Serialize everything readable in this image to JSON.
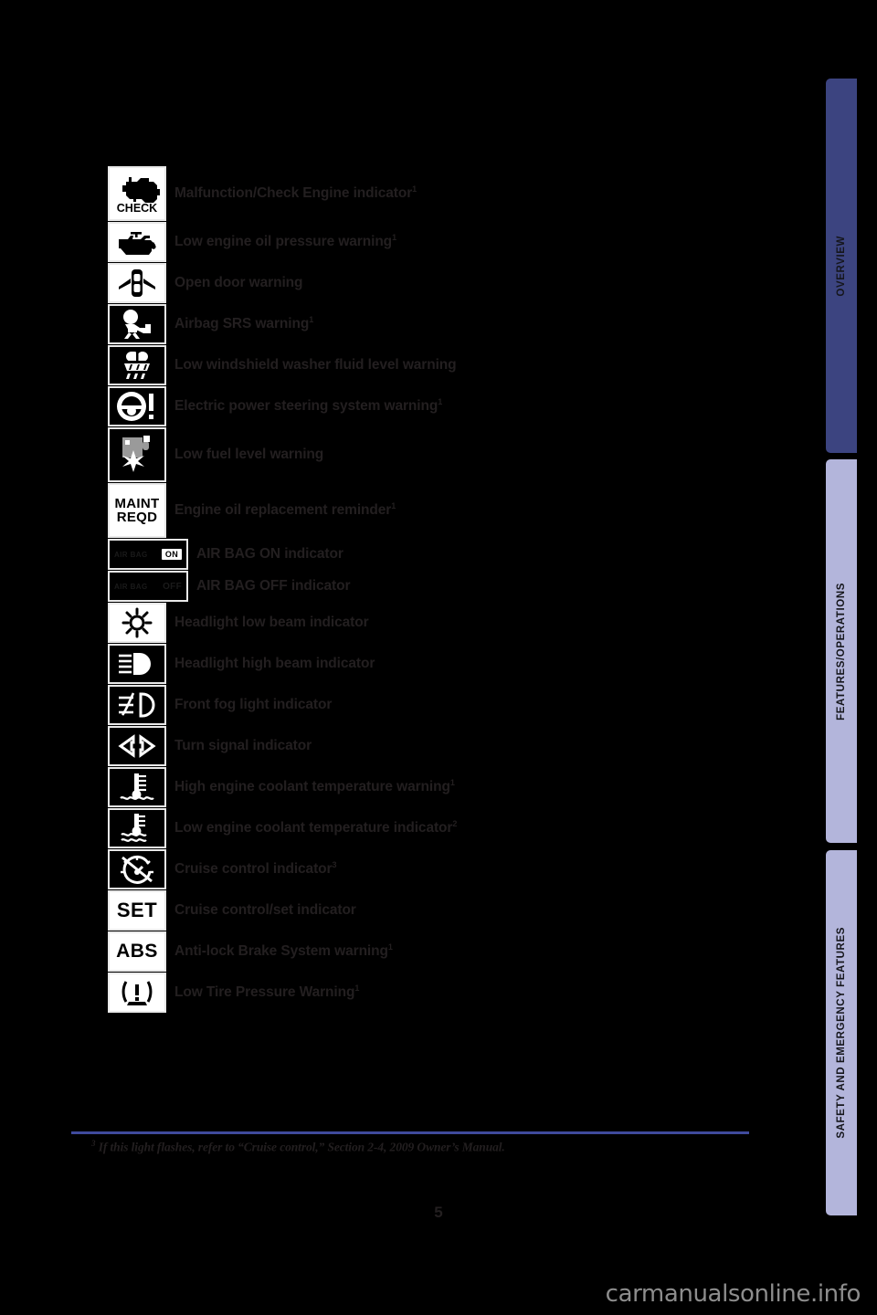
{
  "page": {
    "number": "5",
    "watermark": "carmanualsonline.info",
    "background_color": "#000000",
    "text_color": "#231f20"
  },
  "footnote": {
    "marker": "3",
    "text": "If this light flashes, refer to “Cruise control,” Section 2-4, 2009 Owner’s Manual.",
    "rule_color": "#3f4a9c"
  },
  "indicators": [
    {
      "icon": "check-engine-icon",
      "icon_text": "CHECK",
      "icon_style": "light",
      "label": "Malfunction/Check Engine indicator",
      "footnote": "1"
    },
    {
      "icon": "oil-can-icon",
      "icon_style": "light",
      "label": "Low engine oil pressure warning",
      "footnote": "1"
    },
    {
      "icon": "open-door-icon",
      "icon_style": "light",
      "label": "Open door warning",
      "footnote": ""
    },
    {
      "icon": "airbag-srs-icon",
      "icon_style": "dark",
      "label": "Airbag SRS warning",
      "footnote": "1"
    },
    {
      "icon": "washer-fluid-icon",
      "icon_style": "dark",
      "label": "Low windshield washer fluid level warning",
      "footnote": ""
    },
    {
      "icon": "power-steering-icon",
      "icon_style": "dark",
      "label": "Electric power steering system warning",
      "footnote": "1"
    },
    {
      "icon": "low-fuel-icon",
      "icon_style": "dark",
      "label": "Low fuel level warning",
      "footnote": ""
    },
    {
      "icon": "maint-reqd-icon",
      "icon_text": "MAINT REQD",
      "icon_style": "light",
      "label": "Engine oil replacement reminder",
      "footnote": "1"
    },
    {
      "icon": "air-bag-on-icon",
      "icon_text": "AIR BAG",
      "icon_state": "ON",
      "icon_style": "dark",
      "label": "AIR BAG ON indicator",
      "footnote": ""
    },
    {
      "icon": "air-bag-off-icon",
      "icon_text": "AIR BAG",
      "icon_state": "OFF",
      "icon_style": "dark",
      "label": "AIR BAG OFF indicator",
      "footnote": ""
    },
    {
      "icon": "headlight-low-beam-icon",
      "icon_style": "light",
      "label": "Headlight low beam indicator",
      "footnote": ""
    },
    {
      "icon": "headlight-high-beam-icon",
      "icon_style": "dark",
      "label": "Headlight high beam indicator",
      "footnote": ""
    },
    {
      "icon": "front-fog-light-icon",
      "icon_style": "dark",
      "label": "Front fog light indicator",
      "footnote": ""
    },
    {
      "icon": "turn-signal-icon",
      "icon_style": "dark",
      "label": "Turn signal indicator",
      "footnote": ""
    },
    {
      "icon": "high-coolant-temp-icon",
      "icon_style": "dark",
      "label": "High engine coolant temperature warning",
      "footnote": "1"
    },
    {
      "icon": "low-coolant-temp-icon",
      "icon_style": "dark",
      "label": "Low engine coolant temperature indicator",
      "footnote": "2"
    },
    {
      "icon": "cruise-control-icon",
      "icon_style": "dark",
      "label": "Cruise control indicator",
      "footnote": "3"
    },
    {
      "icon": "cruise-set-icon",
      "icon_text": "SET",
      "icon_style": "dark",
      "label": "Cruise control/set indicator",
      "footnote": ""
    },
    {
      "icon": "abs-icon",
      "icon_text": "ABS",
      "icon_style": "dark",
      "label": "Anti-lock Brake System warning",
      "footnote": "1"
    },
    {
      "icon": "low-tire-pressure-icon",
      "icon_style": "dark",
      "label": "Low Tire Pressure Warning",
      "footnote": "1"
    }
  ],
  "side_tabs": [
    {
      "label": "OVERVIEW",
      "color": "#3c4480",
      "active": true
    },
    {
      "label": "FEATURES/OPERATIONS",
      "color": "#b3b5db",
      "active": false
    },
    {
      "label": "SAFETY AND EMERGENCY FEATURES",
      "color": "#b3b5db",
      "active": false
    }
  ]
}
